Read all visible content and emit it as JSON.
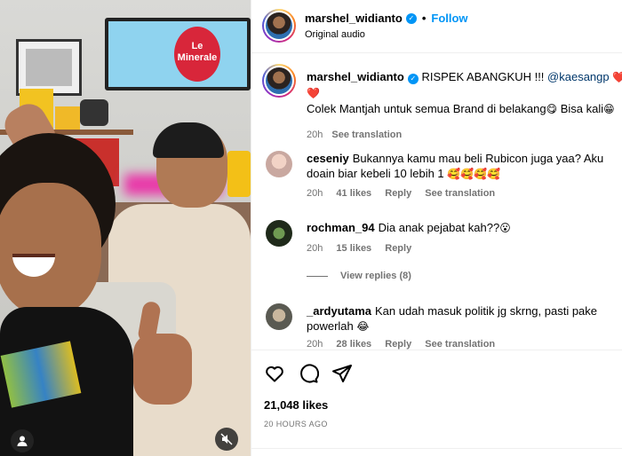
{
  "video": {
    "tv_logo_text": "Le Minerale"
  },
  "header": {
    "username": "marshel_widianto",
    "follow_label": "Follow",
    "subtitle": "Original audio"
  },
  "caption": {
    "username": "marshel_widianto",
    "text_prefix": "RISPEK ABANGKUH !!! ",
    "mention": "@kaesangp",
    "line1_emoji": "❤️❤️",
    "line2_emoji": "❤️",
    "line3": "Colek Mantjah untuk semua Brand di belakang",
    "line3_emoji": "😋",
    "line3_suffix": " Bisa kali",
    "line3_suffix_emoji": "😁",
    "time": "20h",
    "see_translation": "See translation"
  },
  "comments": [
    {
      "username": "ceseniy",
      "text": "Bukannya kamu mau beli Rubicon juga yaa? Aku doain biar kebeli 10 lebih 1 ",
      "emoji": "🥰🥰🥰🥰",
      "time": "20h",
      "likes": "41 likes",
      "reply": "Reply",
      "see_translation": "See translation"
    },
    {
      "username": "rochman_94",
      "text": "Dia anak pejabat kah??",
      "emoji": "😮",
      "time": "20h",
      "likes": "15 likes",
      "reply": "Reply"
    },
    {
      "username": "_ardyutama",
      "text": "Kan udah masuk politik jg skrng, pasti pake powerlah ",
      "emoji": "😂",
      "time": "20h",
      "likes": "28 likes",
      "reply": "Reply",
      "see_translation": "See translation"
    }
  ],
  "view_replies": "View replies (8)",
  "post": {
    "likes": "21,048 likes",
    "time_ago": "20 HOURS AGO"
  },
  "colors": {
    "accent": "#0095f6",
    "muted": "#737373",
    "heart": "#ed2f4a"
  }
}
